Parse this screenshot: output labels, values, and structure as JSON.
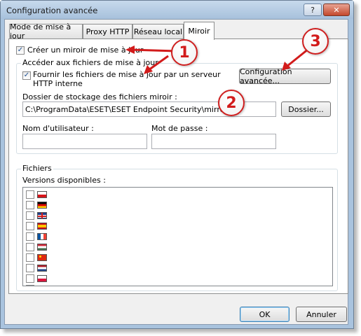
{
  "window": {
    "title": "Configuration avancée",
    "help_glyph": "?",
    "close_glyph": "✕"
  },
  "tabs": [
    {
      "label": "Mode de mise à jour",
      "active": false
    },
    {
      "label": "Proxy HTTP",
      "active": false
    },
    {
      "label": "Réseau local",
      "active": false
    },
    {
      "label": "Miroir",
      "active": true
    }
  ],
  "mirror": {
    "create_mirror_label": "Créer un miroir de mise à jour",
    "create_mirror_checked": true,
    "access_group_title": "Accéder aux fichiers de mise à jour",
    "http_server_label": "Fournir les fichiers de mise à jour par un serveur HTTP interne",
    "http_server_checked": true,
    "advanced_config_button": "Configuration avancée...",
    "storage_folder_label": "Dossier de stockage des fichiers miroir :",
    "storage_folder_value": "C:\\ProgramData\\ESET\\ESET Endpoint Security\\mirror",
    "folder_button": "Dossier...",
    "username_label": "Nom d'utilisateur :",
    "username_value": "",
    "password_label": "Mot de passe :",
    "password_value": ""
  },
  "files": {
    "group_title": "Fichiers",
    "versions_label": "Versions disponibles :",
    "versions": [
      {
        "flag": "czech-flag",
        "checked": false
      },
      {
        "flag": "german-flag",
        "checked": false
      },
      {
        "flag": "uk-flag",
        "checked": false
      },
      {
        "flag": "spain-flag",
        "checked": false
      },
      {
        "flag": "france-flag",
        "checked": false
      },
      {
        "flag": "hungary-flag",
        "checked": false
      },
      {
        "flag": "china-flag",
        "checked": false
      },
      {
        "flag": "netherlands-flag",
        "checked": false
      },
      {
        "flag": "poland-flag",
        "checked": false
      },
      {
        "flag": "romania-flag",
        "checked": false
      }
    ]
  },
  "footer": {
    "ok_button": "OK",
    "cancel_button": "Annuler"
  },
  "annotations": {
    "marker_1": "1",
    "marker_2": "2",
    "marker_3": "3",
    "color": "#d21b1b"
  }
}
